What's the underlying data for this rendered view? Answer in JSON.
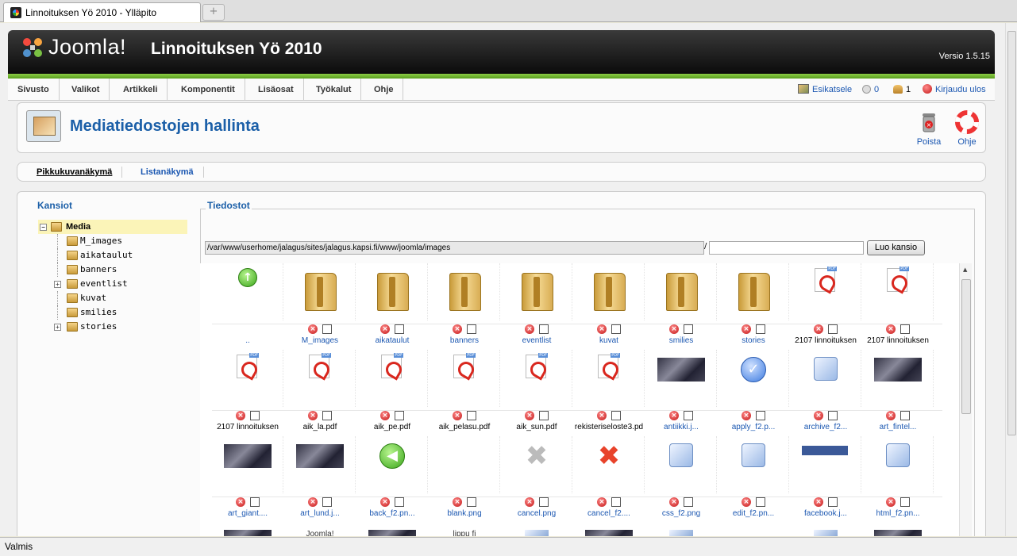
{
  "browser": {
    "tab_title": "Linnoituksen Yö 2010 - Ylläpito",
    "new_tab_symbol": "+",
    "status_text": "Valmis"
  },
  "header": {
    "logo_text": "Joomla!",
    "site_title": "Linnoituksen Yö 2010",
    "version": "Versio 1.5.15"
  },
  "menu": {
    "items": [
      "Sivusto",
      "Valikot",
      "Artikkeli",
      "Komponentit",
      "Lisäosat",
      "Työkalut",
      "Ohje"
    ],
    "preview": "Esikatsele",
    "messages": "0",
    "users": "1",
    "logout": "Kirjaudu ulos"
  },
  "toolbar": {
    "page_title": "Mediatiedostojen hallinta",
    "delete_label": "Poista",
    "help_label": "Ohje"
  },
  "views": {
    "thumbnail": "Pikkukuvanäkymä",
    "list": "Listanäkymä"
  },
  "folders": {
    "title": "Kansiot",
    "root": "Media",
    "items": [
      "M_images",
      "aikataulut",
      "banners",
      "eventlist",
      "kuvat",
      "smilies",
      "stories"
    ]
  },
  "files": {
    "title": "Tiedostot",
    "path": "/var/www/userhome/jalagus/sites/jalagus.kapsi.fi/www/joomla/images",
    "path_separator": "/",
    "create_folder_label": "Luo kansio",
    "row1": [
      "..",
      "M_images",
      "aikataulut",
      "banners",
      "eventlist",
      "kuvat",
      "smilies",
      "stories",
      "2107 linnoituksen",
      "2107 linnoituksen"
    ],
    "row2": [
      "2107 linnoituksen",
      "aik_la.pdf",
      "aik_pe.pdf",
      "aik_pelasu.pdf",
      "aik_sun.pdf",
      "rekisteriseloste3.pd",
      "antiikki.j...",
      "apply_f2.p...",
      "archive_f2...",
      "art_fintel..."
    ],
    "row3": [
      "art_giant....",
      "art_lund.j...",
      "back_f2.pn...",
      "blank.png",
      "cancel.png",
      "cancel_f2....",
      "css_f2.png",
      "edit_f2.pn...",
      "facebook.j...",
      "html_f2.pn..."
    ],
    "row4_partial": [
      "Joomla!",
      "lippu fi"
    ]
  },
  "colors": {
    "accent_blue": "#1b5fa8",
    "header_green": "#6bb42c",
    "delete_red": "#c31717"
  }
}
